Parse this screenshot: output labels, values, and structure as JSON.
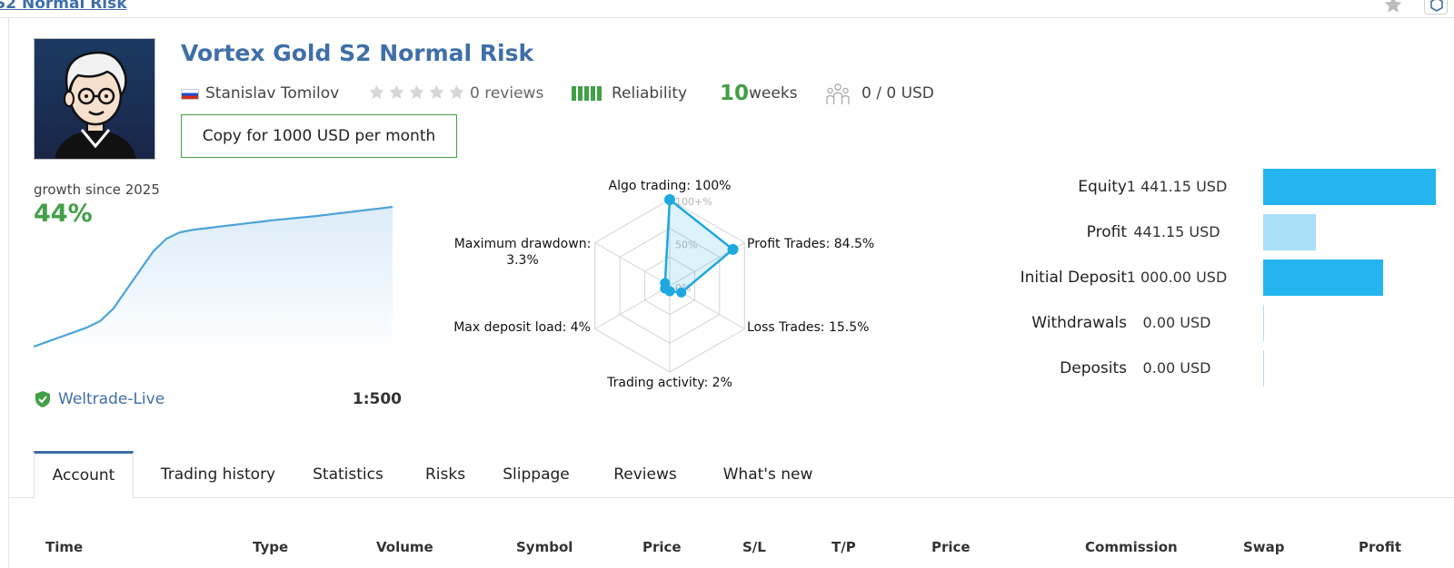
{
  "topbar": {
    "title_link": "S2 Normal Risk"
  },
  "signal": {
    "title": "Vortex Gold S2 Normal Risk",
    "author": "Stanislav Tomilov",
    "rating_stars": 0,
    "reviews": "0 reviews",
    "reliability_label": "Reliability",
    "reliability_level": 5,
    "weeks_value": "10",
    "weeks_label": "weeks",
    "subscribers": "0 / 0 USD",
    "copy_button": "Copy for 1000 USD per month"
  },
  "growth": {
    "label": "growth since 2025",
    "value": "44%",
    "broker": "Weltrade-Live",
    "leverage": "1:500",
    "curve": [
      0,
      1.5,
      3,
      4.5,
      6,
      8,
      12,
      18,
      24,
      30,
      34,
      36,
      36.8,
      37.3,
      37.8,
      38.3,
      38.8,
      39.3,
      39.8,
      40.2,
      40.6,
      41,
      41.5,
      42,
      42.5,
      43,
      43.5,
      44
    ]
  },
  "radar": {
    "axes": [
      {
        "label": "Algo trading: 100%",
        "value": 100
      },
      {
        "label": "Profit Trades: 84.5%",
        "value": 84.5
      },
      {
        "label": "Loss Trades: 15.5%",
        "value": 15.5
      },
      {
        "label": "Trading activity: 2%",
        "value": 2
      },
      {
        "label": "Max deposit load: 4%",
        "value": 4
      },
      {
        "label_line1": "Maximum drawdown:",
        "label_line2": "3.3%",
        "value": 3.3
      }
    ],
    "scale_labels": [
      "100+%",
      "50%",
      "0%"
    ],
    "color": "#1ea8e0"
  },
  "financials": [
    {
      "label": "Equity",
      "value": "1 441.15 USD",
      "amount": 1441.15,
      "color": "#24b5ef"
    },
    {
      "label": "Profit",
      "value": "441.15 USD",
      "amount": 441.15,
      "color": "#a8e0f7"
    },
    {
      "label": "Initial Deposit",
      "value": "1 000.00 USD",
      "amount": 1000,
      "color": "#24b5ef"
    },
    {
      "label": "Withdrawals",
      "value": "0.00 USD",
      "amount": 0,
      "color": "#a8e0f7"
    },
    {
      "label": "Deposits",
      "value": "0.00 USD",
      "amount": 0,
      "color": "#a8e0f7"
    }
  ],
  "tabs": [
    "Account",
    "Trading history",
    "Statistics",
    "Risks",
    "Slippage",
    "Reviews",
    "What's new"
  ],
  "active_tab": "Account",
  "table": {
    "columns": [
      "Time",
      "Type",
      "Volume",
      "Symbol",
      "Price",
      "S/L",
      "T/P",
      "Price",
      "Commission",
      "Swap",
      "Profit"
    ]
  },
  "colors": {
    "link": "#3f6fa8",
    "green": "#43a047",
    "chart_blue": "#4aa3d9"
  }
}
